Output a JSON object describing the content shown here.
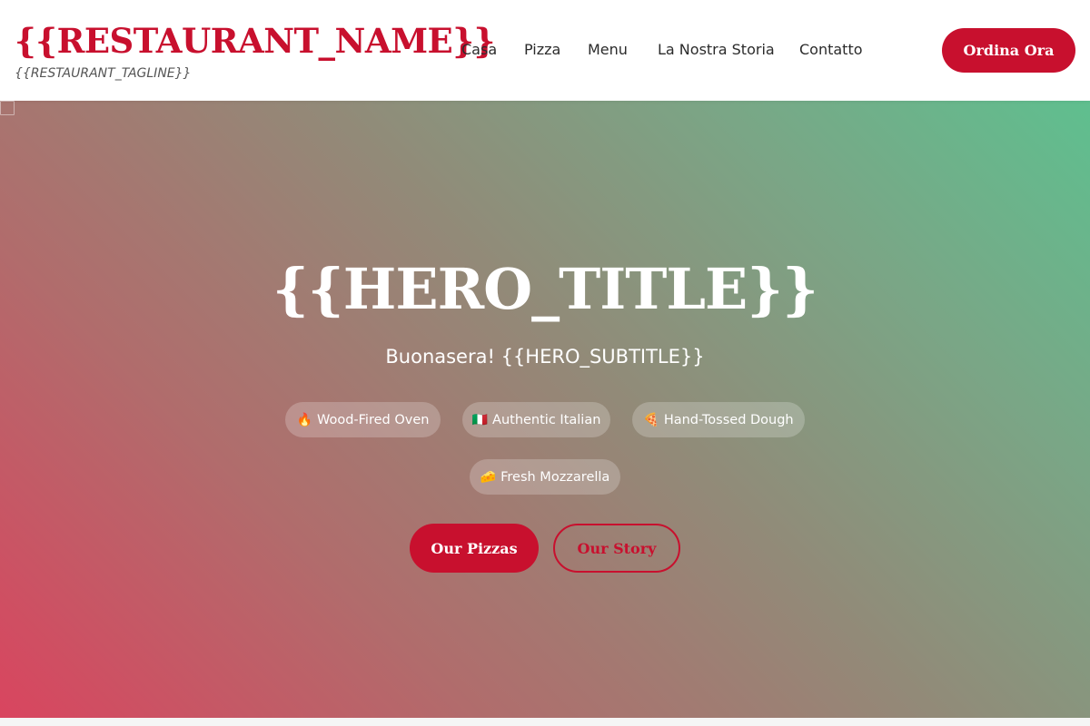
{
  "header": {
    "restaurant_name": "{{RESTAURANT_NAME}}",
    "tagline": "{{RESTAURANT_TAGLINE}}",
    "nav": [
      "Casa",
      "Pizza",
      "Menu",
      "La Nostra Storia",
      "Contatto"
    ],
    "order_button": "Ordina Ora"
  },
  "hero": {
    "title": "{{HERO_TITLE}}",
    "subtitle": "Buonasera! {{HERO_SUBTITLE}}",
    "features": [
      {
        "icon": "fire-icon",
        "emoji": "🔥",
        "label": "Wood-Fired Oven"
      },
      {
        "icon": "italian-flag-icon",
        "emoji": "🇮🇹",
        "label": "Authentic Italian"
      },
      {
        "icon": "pizza-icon",
        "emoji": "🍕",
        "label": "Hand-Tossed Dough"
      },
      {
        "icon": "cheese-icon",
        "emoji": "🧀",
        "label": "Fresh Mozzarella"
      }
    ],
    "primary_button": "Our Pizzas",
    "secondary_button": "Our Story"
  },
  "colors": {
    "brand_red": "#c8102e",
    "gradient_start": "#d9455f",
    "gradient_end": "#5fbf8f"
  }
}
